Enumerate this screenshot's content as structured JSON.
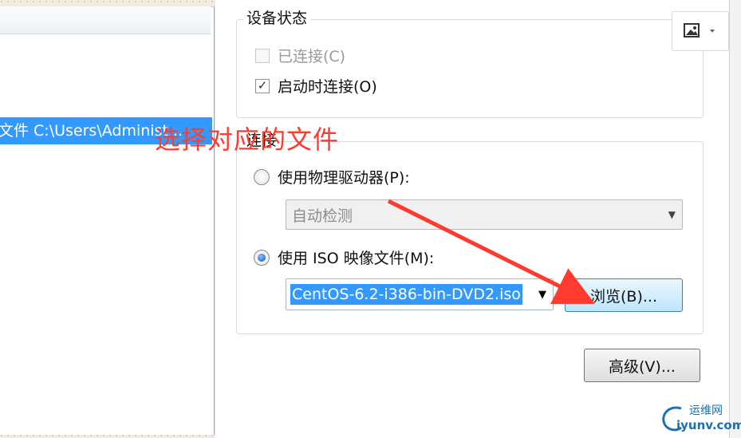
{
  "left_panel": {
    "selected_row_text": "文件 C:\\Users\\Administ..."
  },
  "annotation": {
    "text": "选择对应的文件",
    "color": "#ff3b2f"
  },
  "device_status": {
    "legend": "设备状态",
    "connected": {
      "label": "已连接(C)",
      "checked": false,
      "enabled": false
    },
    "connect_at_power_on": {
      "label": "启动时连接(O)",
      "checked": true,
      "mark": "✓"
    }
  },
  "connection": {
    "legend": "连接",
    "physical_drive": {
      "label": "使用物理驱动器(P):",
      "selected": false
    },
    "physical_drive_select": {
      "value": "自动检测",
      "enabled": false
    },
    "iso_image": {
      "label": "使用 ISO 映像文件(M):",
      "selected": true
    },
    "iso_path": {
      "value": "CentOS-6.2-i386-bin-DVD2.iso"
    },
    "browse_button": "浏览(B)..."
  },
  "advanced_button": "高级(V)...",
  "watermark": {
    "line1": "运维网",
    "line2": "iyunv.com"
  },
  "colors": {
    "selection": "#3399ff",
    "accent_blue": "#1a6fb5"
  }
}
